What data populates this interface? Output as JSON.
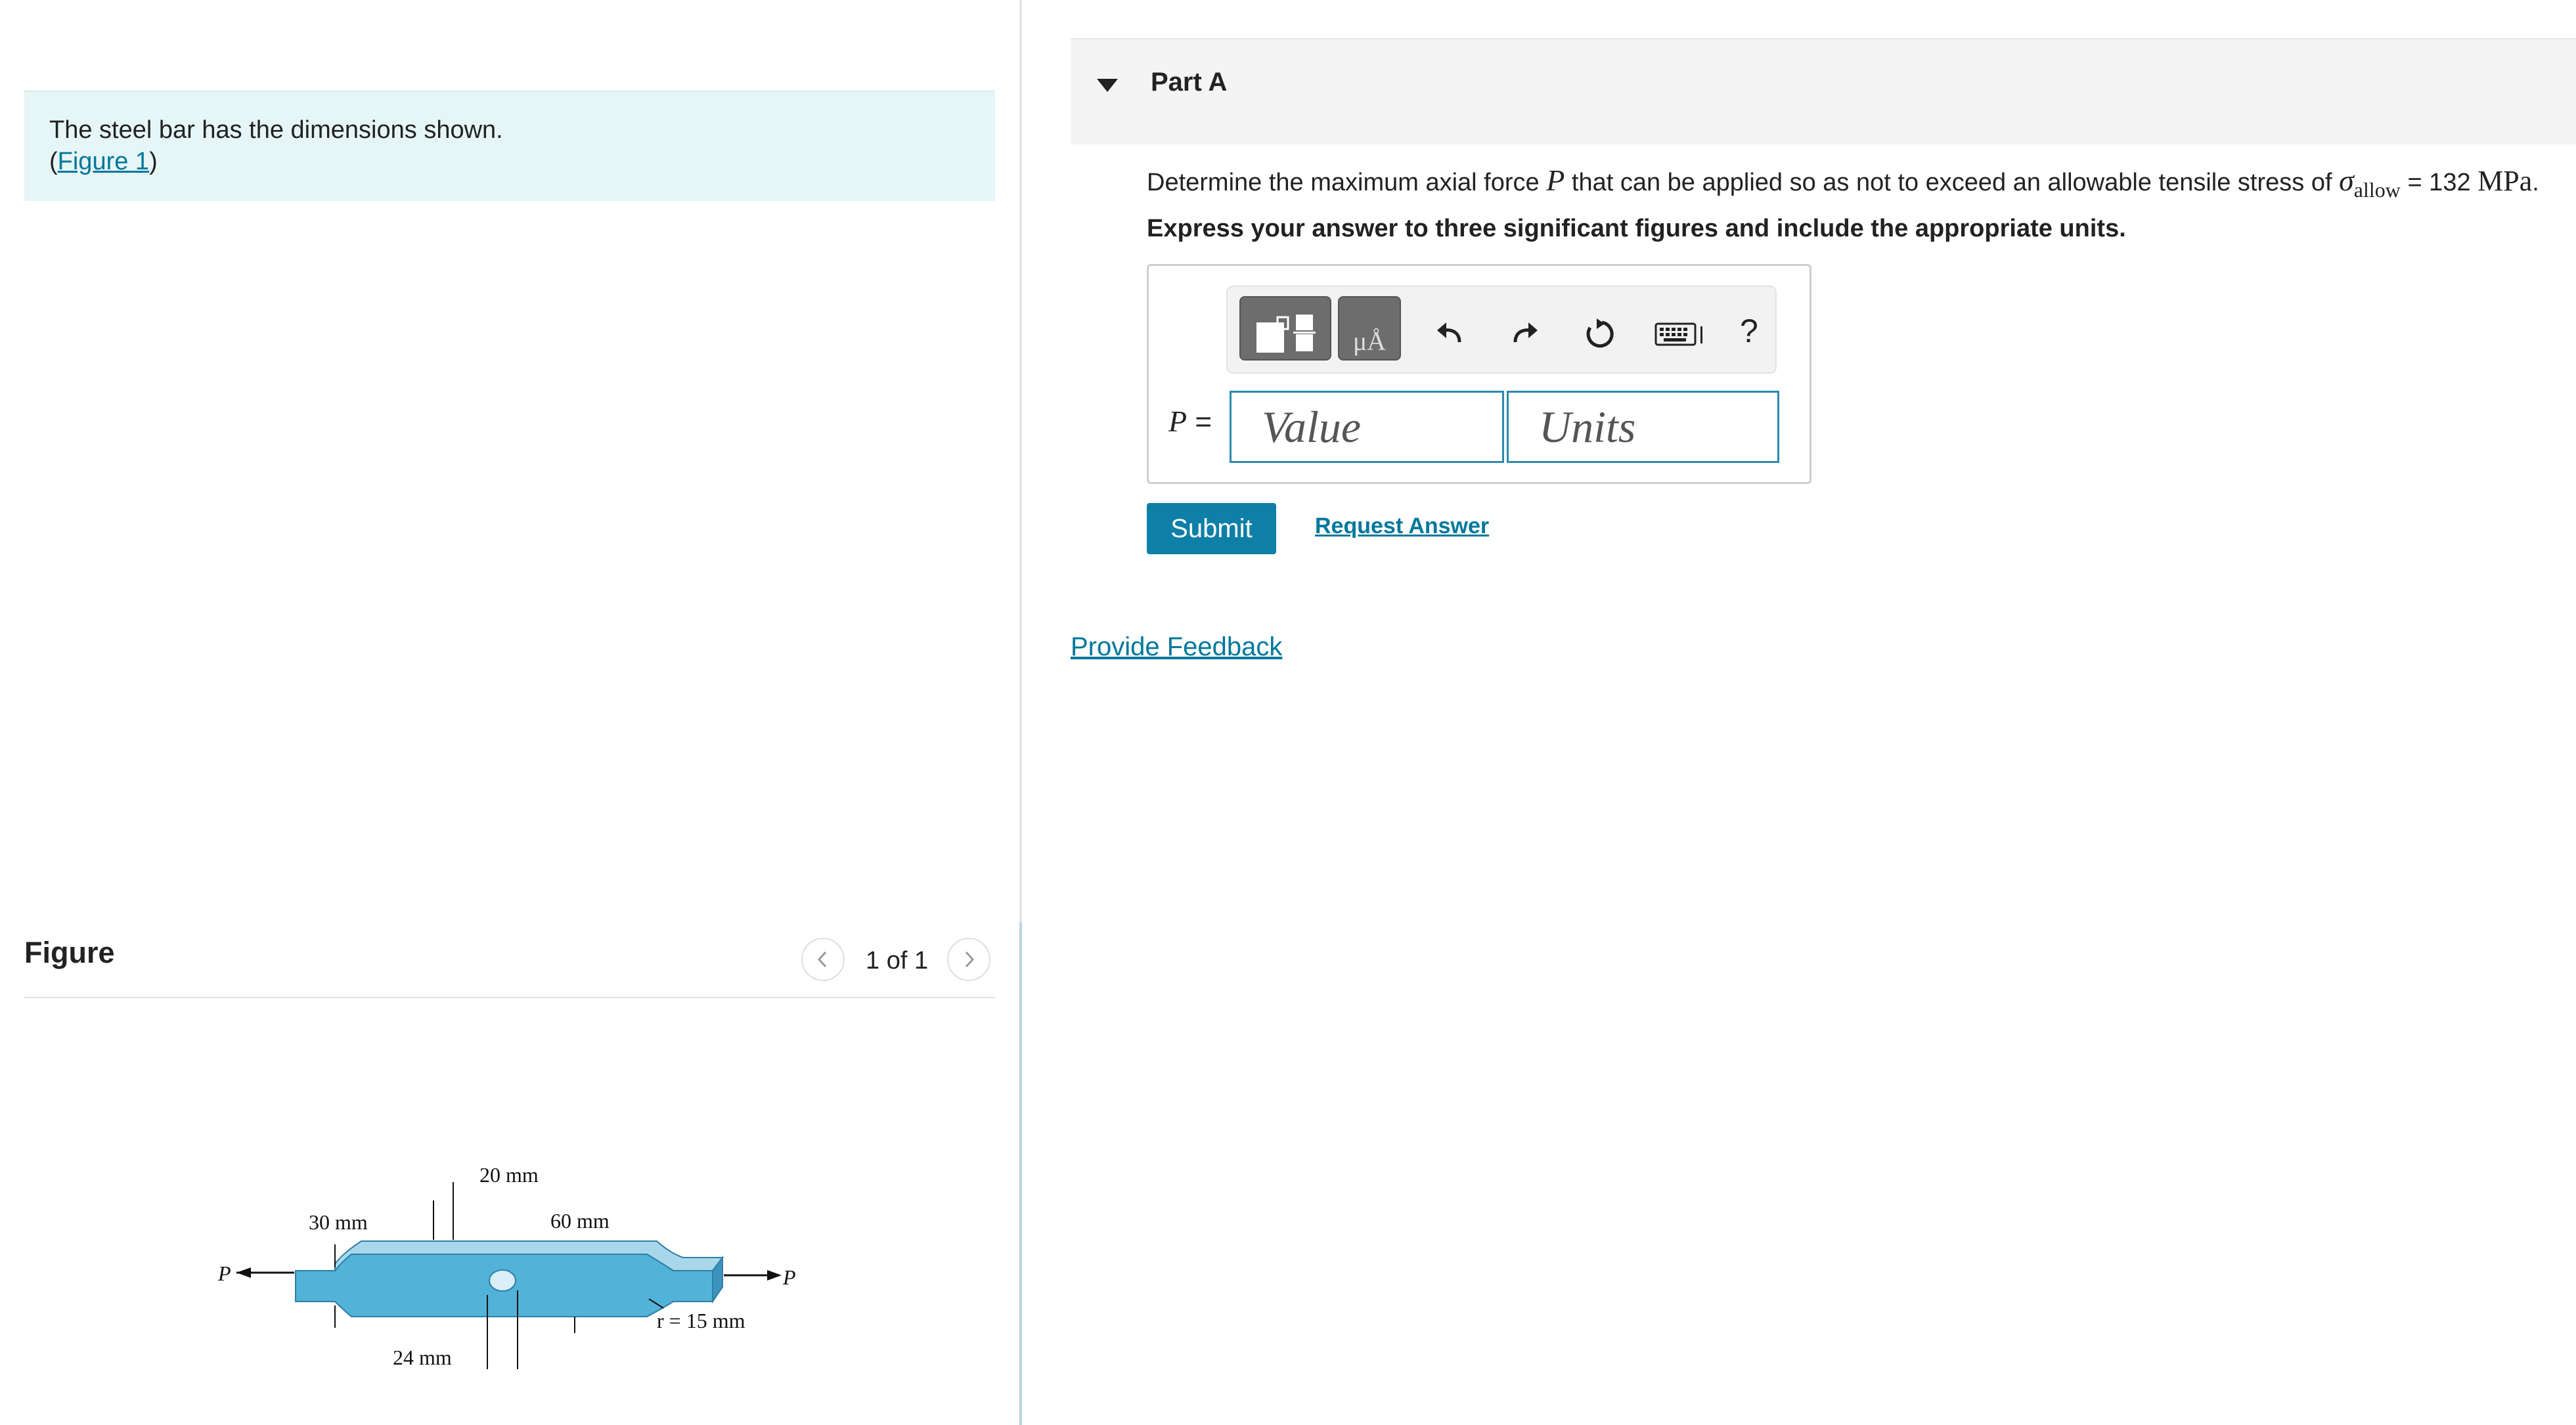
{
  "intro": {
    "text": "The steel bar has the dimensions shown.",
    "figure_link_open": "(",
    "figure_link": "Figure 1",
    "figure_link_close": ")"
  },
  "figure_panel": {
    "title": "Figure",
    "pager": "1 of 1",
    "prev_icon": "chevron-left-icon",
    "next_icon": "chevron-right-icon",
    "labels": {
      "d20": "20 mm",
      "d30": "30 mm",
      "d60": "60 mm",
      "d24": "24 mm",
      "r15": "r = 15 mm",
      "p_left": "P",
      "p_right": "P"
    },
    "colors": {
      "bar_top": "#a9d7ea",
      "bar_front": "#52b2d8",
      "bar_side": "#3c94bd"
    }
  },
  "part": {
    "title": "Part A",
    "caret_icon": "caret-down-icon",
    "question_prefix": "Determine the maximum axial force",
    "question_var": "P",
    "question_mid": "that can be applied so as not to exceed an allowable tensile stress of",
    "sigma": "σ",
    "sigma_sub": "allow",
    "equals_value": "= 132",
    "stress_units": "MPa",
    "period": ".",
    "instruction": "Express your answer to three significant figures and include the appropriate units."
  },
  "answer": {
    "label_var": "P",
    "label_eq": "=",
    "value_placeholder": "Value",
    "units_placeholder": "Units",
    "toolbar": {
      "templates_icon": "templates-icon",
      "units_button_text": "μÅ",
      "undo_icon": "undo-icon",
      "redo_icon": "redo-icon",
      "reset_icon": "reset-icon",
      "keyboard_icon": "keyboard-icon",
      "help_text": "?"
    }
  },
  "actions": {
    "submit": "Submit",
    "request_answer": "Request Answer",
    "feedback": "Provide Feedback"
  },
  "colors": {
    "accent": "#0e7fa6",
    "link": "#00789b",
    "intro_bg": "#e6f5f6"
  }
}
